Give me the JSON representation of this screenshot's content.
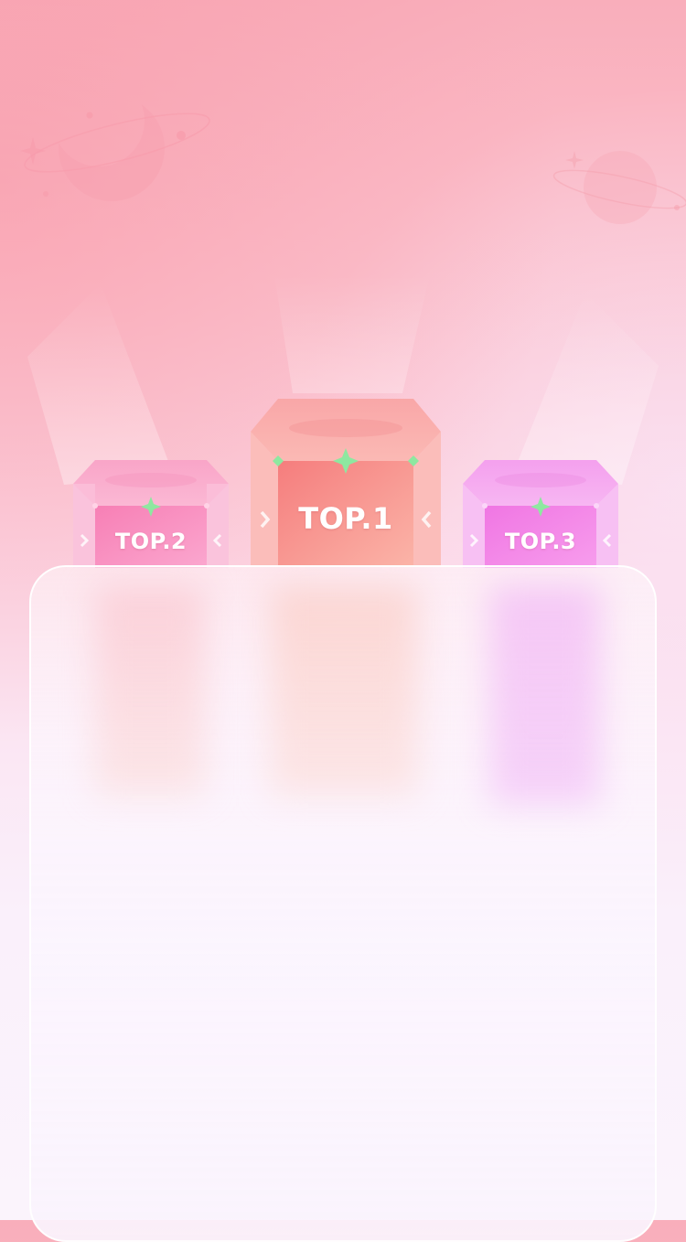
{
  "podiums": [
    {
      "rank": 1,
      "label": "TOP.1",
      "color": "#f8948e"
    },
    {
      "rank": 2,
      "label": "TOP.2",
      "color": "#f99cc3"
    },
    {
      "rank": 3,
      "label": "TOP.3",
      "color": "#f290e8"
    }
  ],
  "colors": {
    "background_top": "#f9aebb",
    "background_bottom": "#fbf4fc",
    "sparkle": "#8ee8a0",
    "panel": "#fbf6fd"
  },
  "icons": {
    "moon": "crescent-moon-icon",
    "planet": "planet-icon",
    "sparkle": "sparkle-star-icon"
  }
}
